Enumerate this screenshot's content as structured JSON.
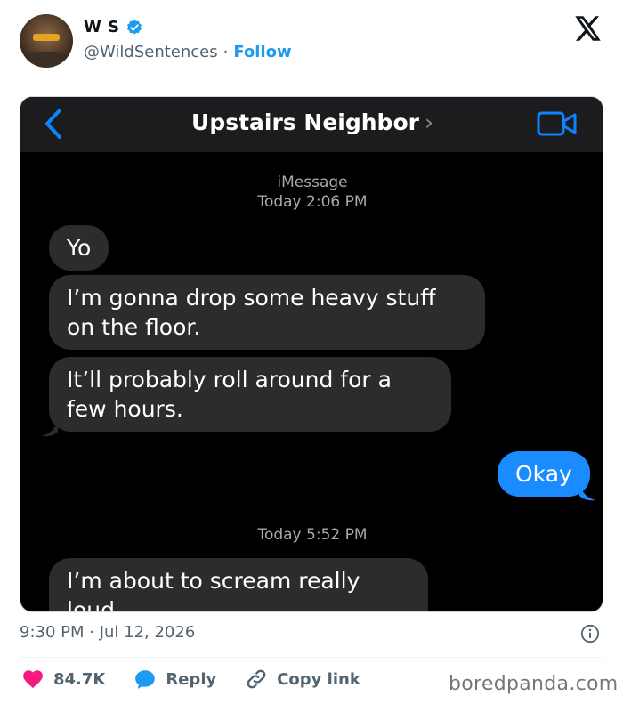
{
  "tweet": {
    "display_name": "W S",
    "handle": "@WildSentences",
    "separator": "·",
    "follow_label": "Follow",
    "timestamp": "9:30 PM · Jul 12, 2026",
    "likes": "84.7K",
    "reply_label": "Reply",
    "copy_link_label": "Copy link",
    "watermark": "boredpanda.com"
  },
  "imessage": {
    "contact_name": "Upstairs Neighbor",
    "contact_chevron": "›",
    "service_label": "iMessage",
    "first_time": "Today 2:06 PM",
    "second_time": "Today 5:52 PM",
    "messages": [
      {
        "sender": "them",
        "text": "Yo"
      },
      {
        "sender": "them",
        "text": "I’m gonna drop some heavy stuff on the floor."
      },
      {
        "sender": "them",
        "text": "It’ll probably roll around for a few hours."
      },
      {
        "sender": "me",
        "text": "Okay"
      },
      {
        "sender": "them",
        "text": "I’m about to scream really loud"
      }
    ]
  },
  "colors": {
    "brand_blue": "#1d9bf0",
    "imessage_blue": "#1a8cff",
    "incoming_bubble": "#2c2c2e",
    "like_pink": "#f91880"
  },
  "icons": [
    "verified-badge-icon",
    "x-logo-icon",
    "back-chevron-icon",
    "video-camera-icon",
    "info-icon",
    "heart-icon",
    "reply-bubble-icon",
    "link-icon"
  ]
}
